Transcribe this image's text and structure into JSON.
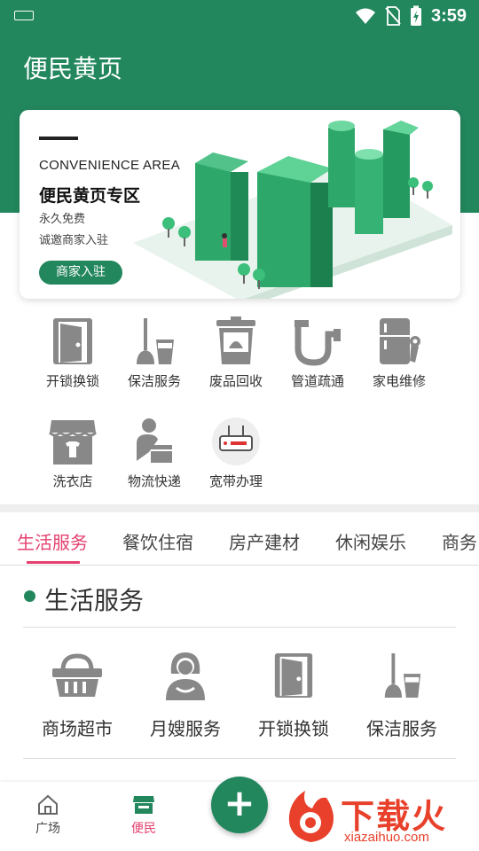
{
  "status_bar": {
    "time": "3:59"
  },
  "header": {
    "title": "便民黄页"
  },
  "banner": {
    "tag_en": "CONVENIENCE AREA",
    "title": "便民黄页专区",
    "line1": "永久免费",
    "line2": "诚邀商家入驻",
    "button": "商家入驻"
  },
  "categories": [
    {
      "label": "开锁换锁",
      "icon": "door-icon"
    },
    {
      "label": "保洁服务",
      "icon": "mop-bucket-icon"
    },
    {
      "label": "废品回收",
      "icon": "trash-bin-icon"
    },
    {
      "label": "管道疏通",
      "icon": "pipe-icon"
    },
    {
      "label": "家电维修",
      "icon": "fridge-wrench-icon"
    },
    {
      "label": "洗衣店",
      "icon": "shop-shirt-icon"
    },
    {
      "label": "物流快递",
      "icon": "courier-icon"
    },
    {
      "label": "宽带办理",
      "icon": "router-icon"
    }
  ],
  "tabs": [
    {
      "label": "生活服务",
      "active": true
    },
    {
      "label": "餐饮住宿"
    },
    {
      "label": "房产建材"
    },
    {
      "label": "休闲娱乐"
    },
    {
      "label": "商务"
    }
  ],
  "section": {
    "title": "生活服务",
    "items": [
      {
        "label": "商场超市",
        "icon": "basket-icon"
      },
      {
        "label": "月嫂服务",
        "icon": "nanny-icon"
      },
      {
        "label": "开锁换锁",
        "icon": "door-icon"
      },
      {
        "label": "保洁服务",
        "icon": "mop-bucket-icon"
      }
    ]
  },
  "bottom_nav": {
    "items": [
      {
        "label": "广场",
        "icon": "home-icon",
        "active": false
      },
      {
        "label": "便民",
        "icon": "store-icon",
        "active": true
      }
    ],
    "fab": "+"
  },
  "watermark": {
    "text": "下载火",
    "url": "xiazaihuo.com"
  },
  "colors": {
    "primary": "#23875e",
    "accent": "#e5406f",
    "icon_gray": "#888888",
    "watermark": "#e8402a"
  }
}
